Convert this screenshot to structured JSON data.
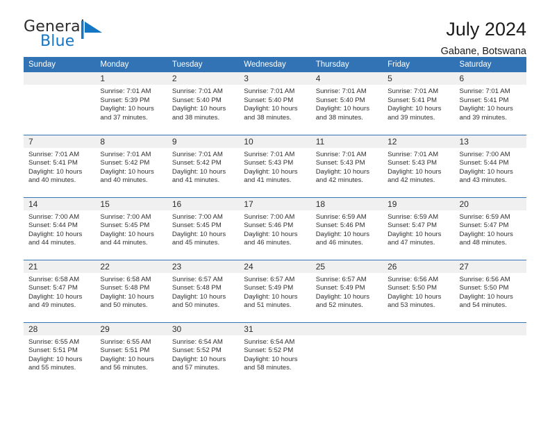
{
  "brand": {
    "name_top": "General",
    "name_bottom": "Blue",
    "mark": "triangle-flag-icon",
    "color_top": "#2b2b2b",
    "color_bottom": "#1576c4",
    "mark_color": "#1576c4"
  },
  "header": {
    "title": "July 2024",
    "subtitle": "Gabane, Botswana"
  },
  "theme": {
    "header_blue": "#3173b5",
    "daynum_band": "#f0f0f0",
    "text": "#2f2f2f"
  },
  "calendar": {
    "weekday_headers": [
      "Sunday",
      "Monday",
      "Tuesday",
      "Wednesday",
      "Thursday",
      "Friday",
      "Saturday"
    ],
    "weeks": [
      [
        {
          "day": "",
          "lines": []
        },
        {
          "day": "1",
          "lines": [
            "Sunrise: 7:01 AM",
            "Sunset: 5:39 PM",
            "Daylight: 10 hours",
            "and 37 minutes."
          ]
        },
        {
          "day": "2",
          "lines": [
            "Sunrise: 7:01 AM",
            "Sunset: 5:40 PM",
            "Daylight: 10 hours",
            "and 38 minutes."
          ]
        },
        {
          "day": "3",
          "lines": [
            "Sunrise: 7:01 AM",
            "Sunset: 5:40 PM",
            "Daylight: 10 hours",
            "and 38 minutes."
          ]
        },
        {
          "day": "4",
          "lines": [
            "Sunrise: 7:01 AM",
            "Sunset: 5:40 PM",
            "Daylight: 10 hours",
            "and 38 minutes."
          ]
        },
        {
          "day": "5",
          "lines": [
            "Sunrise: 7:01 AM",
            "Sunset: 5:41 PM",
            "Daylight: 10 hours",
            "and 39 minutes."
          ]
        },
        {
          "day": "6",
          "lines": [
            "Sunrise: 7:01 AM",
            "Sunset: 5:41 PM",
            "Daylight: 10 hours",
            "and 39 minutes."
          ]
        }
      ],
      [
        {
          "day": "7",
          "lines": [
            "Sunrise: 7:01 AM",
            "Sunset: 5:41 PM",
            "Daylight: 10 hours",
            "and 40 minutes."
          ]
        },
        {
          "day": "8",
          "lines": [
            "Sunrise: 7:01 AM",
            "Sunset: 5:42 PM",
            "Daylight: 10 hours",
            "and 40 minutes."
          ]
        },
        {
          "day": "9",
          "lines": [
            "Sunrise: 7:01 AM",
            "Sunset: 5:42 PM",
            "Daylight: 10 hours",
            "and 41 minutes."
          ]
        },
        {
          "day": "10",
          "lines": [
            "Sunrise: 7:01 AM",
            "Sunset: 5:43 PM",
            "Daylight: 10 hours",
            "and 41 minutes."
          ]
        },
        {
          "day": "11",
          "lines": [
            "Sunrise: 7:01 AM",
            "Sunset: 5:43 PM",
            "Daylight: 10 hours",
            "and 42 minutes."
          ]
        },
        {
          "day": "12",
          "lines": [
            "Sunrise: 7:01 AM",
            "Sunset: 5:43 PM",
            "Daylight: 10 hours",
            "and 42 minutes."
          ]
        },
        {
          "day": "13",
          "lines": [
            "Sunrise: 7:00 AM",
            "Sunset: 5:44 PM",
            "Daylight: 10 hours",
            "and 43 minutes."
          ]
        }
      ],
      [
        {
          "day": "14",
          "lines": [
            "Sunrise: 7:00 AM",
            "Sunset: 5:44 PM",
            "Daylight: 10 hours",
            "and 44 minutes."
          ]
        },
        {
          "day": "15",
          "lines": [
            "Sunrise: 7:00 AM",
            "Sunset: 5:45 PM",
            "Daylight: 10 hours",
            "and 44 minutes."
          ]
        },
        {
          "day": "16",
          "lines": [
            "Sunrise: 7:00 AM",
            "Sunset: 5:45 PM",
            "Daylight: 10 hours",
            "and 45 minutes."
          ]
        },
        {
          "day": "17",
          "lines": [
            "Sunrise: 7:00 AM",
            "Sunset: 5:46 PM",
            "Daylight: 10 hours",
            "and 46 minutes."
          ]
        },
        {
          "day": "18",
          "lines": [
            "Sunrise: 6:59 AM",
            "Sunset: 5:46 PM",
            "Daylight: 10 hours",
            "and 46 minutes."
          ]
        },
        {
          "day": "19",
          "lines": [
            "Sunrise: 6:59 AM",
            "Sunset: 5:47 PM",
            "Daylight: 10 hours",
            "and 47 minutes."
          ]
        },
        {
          "day": "20",
          "lines": [
            "Sunrise: 6:59 AM",
            "Sunset: 5:47 PM",
            "Daylight: 10 hours",
            "and 48 minutes."
          ]
        }
      ],
      [
        {
          "day": "21",
          "lines": [
            "Sunrise: 6:58 AM",
            "Sunset: 5:47 PM",
            "Daylight: 10 hours",
            "and 49 minutes."
          ]
        },
        {
          "day": "22",
          "lines": [
            "Sunrise: 6:58 AM",
            "Sunset: 5:48 PM",
            "Daylight: 10 hours",
            "and 50 minutes."
          ]
        },
        {
          "day": "23",
          "lines": [
            "Sunrise: 6:57 AM",
            "Sunset: 5:48 PM",
            "Daylight: 10 hours",
            "and 50 minutes."
          ]
        },
        {
          "day": "24",
          "lines": [
            "Sunrise: 6:57 AM",
            "Sunset: 5:49 PM",
            "Daylight: 10 hours",
            "and 51 minutes."
          ]
        },
        {
          "day": "25",
          "lines": [
            "Sunrise: 6:57 AM",
            "Sunset: 5:49 PM",
            "Daylight: 10 hours",
            "and 52 minutes."
          ]
        },
        {
          "day": "26",
          "lines": [
            "Sunrise: 6:56 AM",
            "Sunset: 5:50 PM",
            "Daylight: 10 hours",
            "and 53 minutes."
          ]
        },
        {
          "day": "27",
          "lines": [
            "Sunrise: 6:56 AM",
            "Sunset: 5:50 PM",
            "Daylight: 10 hours",
            "and 54 minutes."
          ]
        }
      ],
      [
        {
          "day": "28",
          "lines": [
            "Sunrise: 6:55 AM",
            "Sunset: 5:51 PM",
            "Daylight: 10 hours",
            "and 55 minutes."
          ]
        },
        {
          "day": "29",
          "lines": [
            "Sunrise: 6:55 AM",
            "Sunset: 5:51 PM",
            "Daylight: 10 hours",
            "and 56 minutes."
          ]
        },
        {
          "day": "30",
          "lines": [
            "Sunrise: 6:54 AM",
            "Sunset: 5:52 PM",
            "Daylight: 10 hours",
            "and 57 minutes."
          ]
        },
        {
          "day": "31",
          "lines": [
            "Sunrise: 6:54 AM",
            "Sunset: 5:52 PM",
            "Daylight: 10 hours",
            "and 58 minutes."
          ]
        },
        {
          "day": "",
          "lines": []
        },
        {
          "day": "",
          "lines": []
        },
        {
          "day": "",
          "lines": []
        }
      ]
    ]
  }
}
